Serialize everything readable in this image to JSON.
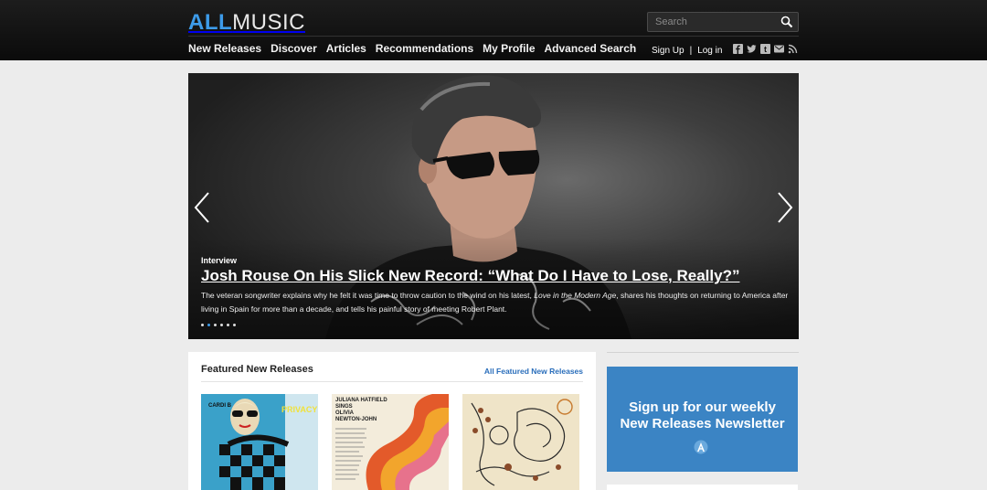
{
  "logo": {
    "part1": "ALL",
    "part2": "MUSIC"
  },
  "search": {
    "placeholder": "Search"
  },
  "nav": [
    "New Releases",
    "Discover",
    "Articles",
    "Recommendations",
    "My Profile",
    "Advanced Search"
  ],
  "account": {
    "signup": "Sign Up",
    "separator": "|",
    "login": "Log in"
  },
  "social_icons": [
    "facebook-icon",
    "twitter-icon",
    "tumblr-icon",
    "email-icon",
    "rss-icon"
  ],
  "hero": {
    "kicker": "Interview",
    "headline": "Josh Rouse On His Slick New Record: “What Do I Have to Lose, Really?”",
    "dek_part1": "The veteran songwriter explains why he felt it was time to throw caution to the wind on his latest, ",
    "dek_album": "Love in the Modern Age",
    "dek_part2": ", shares his thoughts on returning to America after living in Spain for more than a decade, and tells his painful story of meeting Robert Plant.",
    "slide_count": 6,
    "active_slide": 1
  },
  "featured": {
    "title": "Featured New Releases",
    "all_link": "All Featured New Releases",
    "covers": [
      {
        "name": "cover-cardi-b",
        "text1": "CARDI B",
        "text2": "PRIVACY"
      },
      {
        "name": "cover-juliana-hatfield",
        "text1": "JULIANA HATFIELD",
        "text2": "SINGS",
        "text3": "OLIVIA",
        "text4": "NEWTON-JOHN"
      },
      {
        "name": "cover-third",
        "text1": ""
      }
    ]
  },
  "promo": {
    "line1": "Sign up for our weekly",
    "line2": "New Releases Newsletter"
  },
  "colors": {
    "brand": "#3d9be9",
    "promo_bg": "#3b84c4",
    "link": "#2a6ebb",
    "header_bg": "#111111"
  }
}
